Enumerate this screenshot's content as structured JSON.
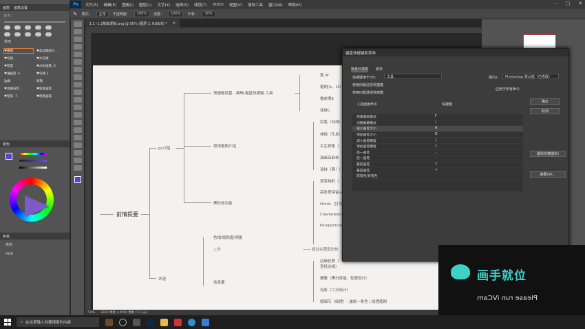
{
  "menubar": {
    "items": [
      "文件(F)",
      "编辑(E)",
      "图像(I)",
      "图层(L)",
      "文字(Y)",
      "选择(S)",
      "滤镜(T)",
      "3D(D)",
      "视图(V)",
      "增效工具",
      "窗口(W)",
      "帮助(H)"
    ]
  },
  "optbar": {
    "mode_label": "模式：",
    "mode_value": "正常",
    "opacity_label": "不透明度：",
    "opacity_value": "100%",
    "flow_label": "流量：",
    "flow_value": "100%",
    "smoothing_label": "平滑：",
    "smoothing_value": "10%"
  },
  "leftpanel": {
    "tabs": [
      "画笔",
      "画笔设置"
    ],
    "size_label": "大小：",
    "group_label": "常用",
    "brushes": [
      [
        "♥硬圆",
        "♥柔边圆压力..."
      ],
      [
        "♥勾线",
        "♥大勾线"
      ],
      [
        "♥铅笔",
        "♥水彩画笔 -2"
      ],
      [
        "♥油画笔 -1",
        "♥勾线 2"
      ],
      [
        "边缘",
        "喷溅"
      ],
      [
        "♥边缘白炽...",
        "♥铅笔画笔"
      ],
      [
        "♥铅笔 -7",
        "♥喷溅画笔"
      ]
    ],
    "color_tab": "颜色",
    "layers_tab": "色板",
    "swatch_groups": [
      "常用",
      "RGB"
    ]
  },
  "doctab": {
    "title": "1.1 -1.2基础逻辑.png @ 50% (图层 2, RGB/8) *"
  },
  "doc": {
    "root": "前情提要",
    "l1": [
      "ps介绍",
      "术语"
    ],
    "ps_children": [
      "快捷键设置 - 编辑-键盘快捷键-工具",
      "常用笔刷介绍",
      "黑科技功能"
    ],
    "shortcut_leaves": [
      "笔 W",
      "笔刷[A，1D",
      "橡皮擦E",
      "涂抹C"
    ],
    "brush_leaves": [
      "铅笔（勾线）",
      "排线（头发）",
      "古生物笔（",
      "油画亚麻布",
      "涂抹（爽！）"
    ],
    "tech_leaves": [
      "渐变映射（",
      "高反差保留+",
      "Oniric（打光",
      "Chameleon",
      "Perspective"
    ],
    "term_children": [
      "色相/饱和度/明度",
      "二分",
      "信息量"
    ],
    "erfen_note": "—— 经过主观设计的",
    "info_leaves": [
      "边缘轮廓（",
      "查找边缘）",
      "横叠（黑白穿插，轮廓设计）",
      "光影（二分设计）",
      "假细节（纹理）- 波纹一条色 | 纹理笔刷"
    ]
  },
  "status": {
    "zoom": "50%",
    "dims": "3838 像素 x 4990 像素 (72 ppi)"
  },
  "dialog": {
    "title": "键盘快捷键和菜单",
    "tabs": [
      "键盘快捷键",
      "菜单"
    ],
    "for_label": "快捷键用于(H):",
    "for_value": "工具",
    "set_label": "组(S):",
    "set_value": "Photoshop 默认值（已修改）",
    "chk1": "使用旧版还原快捷键",
    "chk2": "使用旧版通道快捷键",
    "chk3": "应用于所有命令",
    "col1": "工具面板命令",
    "col2": "快捷键",
    "rows": [
      [
        "快速蒙版模式",
        "F"
      ],
      [
        "切换屏幕模式",
        "/"
      ],
      [
        "减小画笔大小",
        "A"
      ],
      [
        "增加画笔大小",
        "D"
      ],
      [
        "减小画笔硬度",
        "{"
      ],
      [
        "增加画笔硬度",
        "}"
      ],
      [
        "前一画笔",
        ","
      ],
      [
        "后一画笔",
        "."
      ],
      [
        "最前画笔",
        "<"
      ],
      [
        "最后画笔",
        ">"
      ],
      [
        "前景色/背景色",
        ""
      ]
    ],
    "btns": [
      "确定",
      "取消",
      "",
      "删除快捷键(E)",
      "摘要(M)..."
    ]
  },
  "video": {
    "brand": "画手就位",
    "mirror": "Please run iVCam"
  },
  "taskbar": {
    "search": "在这里输入你要搜索的内容"
  },
  "colors": {
    "accent": "#31a8ff",
    "brand": "#3fd1c5",
    "select": "#e0762e"
  }
}
